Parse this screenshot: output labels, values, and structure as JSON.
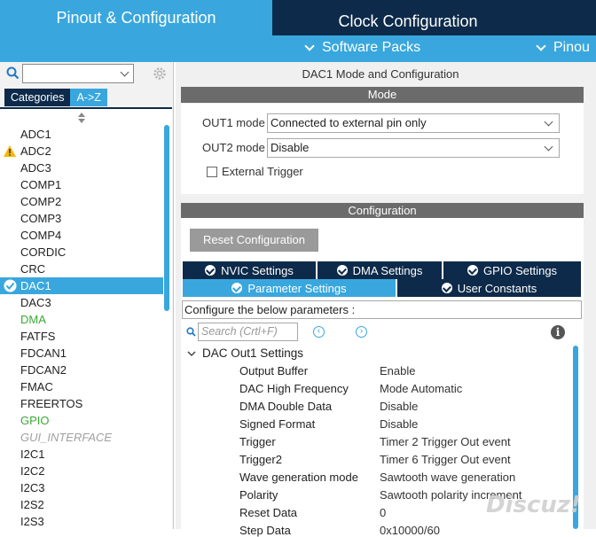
{
  "top_tabs": {
    "pinout": "Pinout & Configuration",
    "clock": "Clock Configuration"
  },
  "packs_bar": {
    "software_packs": "Software Packs",
    "pinout": "Pinou"
  },
  "left": {
    "search_value": "",
    "tabs": {
      "categories": "Categories",
      "az": "A->Z"
    },
    "items": [
      {
        "label": "ADC1",
        "state": "normal"
      },
      {
        "label": "ADC2",
        "state": "warning"
      },
      {
        "label": "ADC3",
        "state": "normal"
      },
      {
        "label": "COMP1",
        "state": "normal"
      },
      {
        "label": "COMP2",
        "state": "normal"
      },
      {
        "label": "COMP3",
        "state": "normal"
      },
      {
        "label": "COMP4",
        "state": "normal"
      },
      {
        "label": "CORDIC",
        "state": "normal"
      },
      {
        "label": "CRC",
        "state": "normal"
      },
      {
        "label": "DAC1",
        "state": "selected"
      },
      {
        "label": "DAC3",
        "state": "normal"
      },
      {
        "label": "DMA",
        "state": "green"
      },
      {
        "label": "FATFS",
        "state": "normal"
      },
      {
        "label": "FDCAN1",
        "state": "normal"
      },
      {
        "label": "FDCAN2",
        "state": "normal"
      },
      {
        "label": "FMAC",
        "state": "normal"
      },
      {
        "label": "FREERTOS",
        "state": "normal"
      },
      {
        "label": "GPIO",
        "state": "green"
      },
      {
        "label": "GUI_INTERFACE",
        "state": "disabled"
      },
      {
        "label": "I2C1",
        "state": "normal"
      },
      {
        "label": "I2C2",
        "state": "normal"
      },
      {
        "label": "I2C3",
        "state": "normal"
      },
      {
        "label": "I2S2",
        "state": "normal"
      },
      {
        "label": "I2S3",
        "state": "normal"
      }
    ]
  },
  "mode_panel": {
    "title": "DAC1 Mode and Configuration",
    "mode_header": "Mode",
    "out1_label": "OUT1 mode",
    "out1_value": "Connected to external pin only",
    "out2_label": "OUT2 mode",
    "out2_value": "Disable",
    "external_trigger_label": "External Trigger",
    "external_trigger_checked": false
  },
  "config_panel": {
    "header": "Configuration",
    "reset_button": "Reset Configuration",
    "tabs": {
      "nvic": "NVIC Settings",
      "dma": "DMA Settings",
      "gpio": "GPIO Settings",
      "parameter": "Parameter Settings",
      "user_constants": "User Constants"
    },
    "info_text": "Configure the below parameters :",
    "search_placeholder": "Search (Crtl+F)",
    "group_title": "DAC Out1 Settings",
    "params": [
      {
        "name": "Output Buffer",
        "value": "Enable"
      },
      {
        "name": "DAC High Frequency",
        "value": "Mode Automatic"
      },
      {
        "name": "DMA Double Data",
        "value": "Disable"
      },
      {
        "name": "Signed Format",
        "value": "Disable"
      },
      {
        "name": "Trigger",
        "value": "Timer 2 Trigger Out event"
      },
      {
        "name": "Trigger2",
        "value": "Timer 6 Trigger Out event"
      },
      {
        "name": "Wave generation mode",
        "value": "Sawtooth wave generation"
      },
      {
        "name": "Polarity",
        "value": "Sawtooth polarity increment"
      },
      {
        "name": "Reset Data",
        "value": "0"
      }
    ]
  },
  "watermark": "Discuz!",
  "colors": {
    "accent": "#39a7dd",
    "dark": "#0d2a4a",
    "header_gray": "#6b6b6b",
    "green": "#3aaa35"
  }
}
